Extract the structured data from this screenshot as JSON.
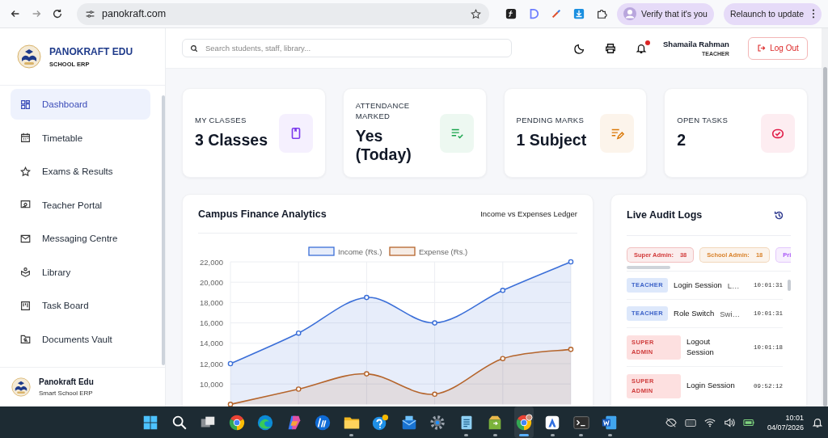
{
  "browser": {
    "url": "panokraft.com",
    "profile_chip": "Verify that it's you",
    "update_chip": "Relaunch to update"
  },
  "brand": {
    "name": "PANOKRAFT EDU",
    "subtitle": "SCHOOL ERP"
  },
  "sidebar": {
    "items": [
      {
        "label": "Dashboard",
        "selected": true
      },
      {
        "label": "Timetable",
        "selected": false
      },
      {
        "label": "Exams & Results",
        "selected": false
      },
      {
        "label": "Teacher Portal",
        "selected": false
      },
      {
        "label": "Messaging Centre",
        "selected": false
      },
      {
        "label": "Library",
        "selected": false
      },
      {
        "label": "Task Board",
        "selected": false
      },
      {
        "label": "Documents Vault",
        "selected": false
      }
    ],
    "footer": {
      "name": "Panokraft Edu",
      "subtitle": "Smart School ERP"
    }
  },
  "header": {
    "search": {
      "placeholder": "Search students, staff, library..."
    },
    "notification_dot": true,
    "user": {
      "name": "Shamaila Rahman",
      "role": "TEACHER"
    },
    "logout": "Log Out"
  },
  "stats": [
    {
      "label": "MY CLASSES",
      "value": "3 Classes",
      "color": "#7c3aed"
    },
    {
      "label": "ATTENDANCE MARKED",
      "value": "Yes (Today)",
      "color": "#16a34a"
    },
    {
      "label": "PENDING MARKS",
      "value": "1 Subject",
      "color": "#d97706"
    },
    {
      "label": "OPEN TASKS",
      "value": "2",
      "color": "#e11d48"
    }
  ],
  "finance": {
    "title": "Campus Finance Analytics",
    "subtitle": "Income vs Expenses Ledger",
    "chart_data": {
      "type": "area",
      "ylim": [
        8000,
        22000
      ],
      "grid": true,
      "legend": "top",
      "yticks": [
        {
          "value": 10000,
          "label": "10,000"
        },
        {
          "value": 12000,
          "label": "12,000"
        },
        {
          "value": 14000,
          "label": "14,000"
        },
        {
          "value": 16000,
          "label": "16,000"
        },
        {
          "value": 18000,
          "label": "18,000"
        },
        {
          "value": 20000,
          "label": "20,000"
        },
        {
          "value": 22000,
          "label": "22,000"
        }
      ],
      "series": [
        {
          "name": "Income (Rs.)",
          "color": "#3b6fd8",
          "values": [
            12000,
            15000,
            18500,
            16000,
            19200,
            22000
          ]
        },
        {
          "name": "Expense (Rs.)",
          "color": "#b5652c",
          "values": [
            8000,
            9500,
            11000,
            9000,
            12500,
            13400
          ]
        }
      ]
    }
  },
  "audit": {
    "title": "Live Audit Logs",
    "chips": [
      {
        "label": "Super Admin:",
        "count": "38",
        "color": "#d23b3b"
      },
      {
        "label": "School Admin:",
        "count": "18",
        "color": "#d9822b"
      },
      {
        "label": "Pri",
        "color": "#a855f7"
      }
    ],
    "rows": [
      {
        "role": "TEACHER",
        "kind": "teacher",
        "action": "Login Session",
        "detail": "L…",
        "time": "10:01:31"
      },
      {
        "role": "TEACHER",
        "kind": "teacher",
        "action": "Role Switch",
        "detail": "Swi…",
        "time": "10:01:31"
      },
      {
        "role": "SUPER ADMIN",
        "kind": "super_admin",
        "action": "Logout Session",
        "time": "10:01:18"
      },
      {
        "role": "SUPER ADMIN",
        "kind": "super_admin",
        "action": "Login Session",
        "time": "09:52:12"
      }
    ]
  },
  "taskbar": {
    "apps": [
      {
        "running": false,
        "selected": false
      },
      {
        "running": false,
        "selected": false
      },
      {
        "running": false,
        "selected": false
      },
      {
        "running": false,
        "selected": false
      },
      {
        "running": false,
        "selected": false
      },
      {
        "running": false,
        "selected": false
      },
      {
        "running": false,
        "selected": false
      },
      {
        "running": true,
        "selected": false
      },
      {
        "running": false,
        "selected": false
      },
      {
        "running": false,
        "selected": false
      },
      {
        "running": false,
        "selected": false
      },
      {
        "running": true,
        "selected": false
      },
      {
        "running": true,
        "selected": false
      },
      {
        "running": true,
        "selected": true
      },
      {
        "running": true,
        "selected": false
      },
      {
        "running": true,
        "selected": false
      },
      {
        "running": true,
        "selected": false
      }
    ],
    "time": "10:01",
    "date": "04/07/2026"
  }
}
